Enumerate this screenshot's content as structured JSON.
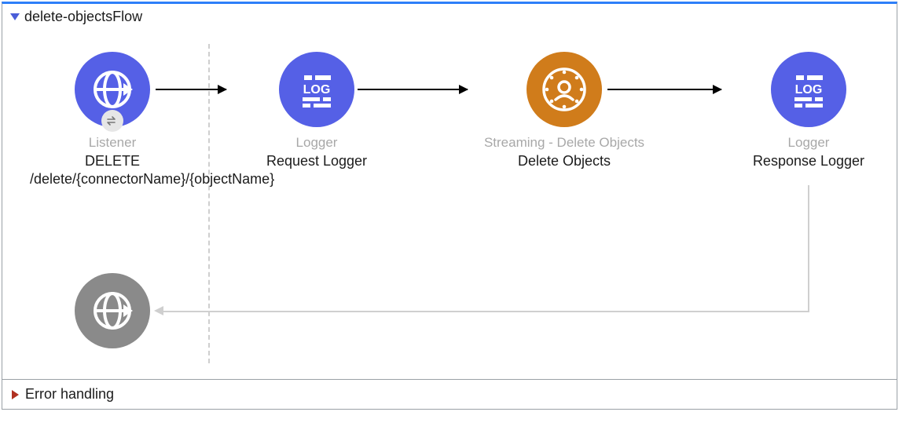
{
  "flow": {
    "title": "delete-objectsFlow",
    "errorSection": "Error handling",
    "nodes": {
      "listener": {
        "type": "Listener",
        "label": "DELETE /delete/{connectorName}/{objectName}"
      },
      "requestLogger": {
        "type": "Logger",
        "label": "Request Logger"
      },
      "deleteObjects": {
        "type": "Streaming - Delete Objects",
        "label": "Delete Objects"
      },
      "responseLogger": {
        "type": "Logger",
        "label": "Response Logger"
      }
    }
  },
  "colors": {
    "blue": "#5560e6",
    "orange": "#d07c1b",
    "gray": "#8a8a8a",
    "accent": "#2d7ff9"
  }
}
